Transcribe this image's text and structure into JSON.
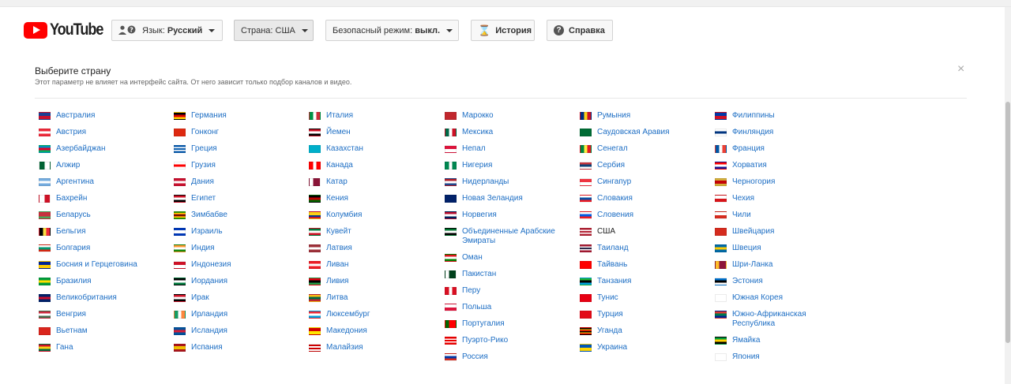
{
  "header": {
    "logo_text": "YouTube",
    "language_prefix": "Язык: ",
    "language_value": "Русский",
    "country_label": "Страна: США",
    "safety_label": "Безопасный режим: ",
    "safety_value": "выкл.",
    "history_label": "История",
    "help_label": "Справка"
  },
  "panel": {
    "title": "Выберите страну",
    "subtitle": "Этот параметр не влияет на интерфейс сайта. От него зависит только подбор каналов и видео.",
    "close_symbol": "×",
    "selected_country": "США"
  },
  "columns": [
    [
      {
        "name": "Австралия",
        "colors": [
          "#1b3f94",
          "#c8102e"
        ]
      },
      {
        "name": "Австрия",
        "colors": [
          "#ed2939",
          "#ffffff",
          "#ed2939"
        ]
      },
      {
        "name": "Азербайджан",
        "colors": [
          "#0092bc",
          "#e4002b",
          "#00af66"
        ]
      },
      {
        "name": "Алжир",
        "colors": [
          "#006233",
          "#ffffff"
        ],
        "dir": "h"
      },
      {
        "name": "Аргентина",
        "colors": [
          "#74acdf",
          "#ffffff",
          "#74acdf"
        ]
      },
      {
        "name": "Бахрейн",
        "colors": [
          "#ffffff",
          "#ce1126"
        ],
        "dir": "h"
      },
      {
        "name": "Беларусь",
        "colors": [
          "#c8313e",
          "#c8313e",
          "#4aa657"
        ]
      },
      {
        "name": "Бельгия",
        "colors": [
          "#000000",
          "#fae042",
          "#ed2939"
        ],
        "dir": "h"
      },
      {
        "name": "Болгария",
        "colors": [
          "#ffffff",
          "#00966e",
          "#d62612"
        ]
      },
      {
        "name": "Босния и Герцеговина",
        "colors": [
          "#002395",
          "#fecb00"
        ]
      },
      {
        "name": "Бразилия",
        "colors": [
          "#009c3b",
          "#ffdf00",
          "#009c3b"
        ]
      },
      {
        "name": "Великобритания",
        "colors": [
          "#012169",
          "#c8102e",
          "#012169"
        ]
      },
      {
        "name": "Венгрия",
        "colors": [
          "#cd2a3e",
          "#ffffff",
          "#436f4d"
        ]
      },
      {
        "name": "Вьетнам",
        "colors": [
          "#da251d",
          "#da251d"
        ]
      },
      {
        "name": "Гана",
        "colors": [
          "#ce1126",
          "#fcd116",
          "#006b3f"
        ]
      }
    ],
    [
      {
        "name": "Германия",
        "colors": [
          "#000000",
          "#dd0000",
          "#ffce00"
        ]
      },
      {
        "name": "Гонконг",
        "colors": [
          "#de2910",
          "#de2910"
        ]
      },
      {
        "name": "Греция",
        "colors": [
          "#0d5eaf",
          "#ffffff",
          "#0d5eaf",
          "#ffffff",
          "#0d5eaf"
        ]
      },
      {
        "name": "Грузия",
        "colors": [
          "#ffffff",
          "#ff0000",
          "#ffffff"
        ]
      },
      {
        "name": "Дания",
        "colors": [
          "#c8102e",
          "#ffffff",
          "#c8102e"
        ]
      },
      {
        "name": "Египет",
        "colors": [
          "#ce1126",
          "#ffffff",
          "#000000"
        ]
      },
      {
        "name": "Зимбабве",
        "colors": [
          "#319208",
          "#ffd200",
          "#de2010",
          "#000000",
          "#de2010",
          "#ffd200",
          "#319208"
        ]
      },
      {
        "name": "Израиль",
        "colors": [
          "#0038b8",
          "#ffffff",
          "#ffffff",
          "#0038b8"
        ]
      },
      {
        "name": "Индия",
        "colors": [
          "#ff9933",
          "#ffffff",
          "#138808"
        ]
      },
      {
        "name": "Индонезия",
        "colors": [
          "#ce1126",
          "#ffffff"
        ]
      },
      {
        "name": "Иордания",
        "colors": [
          "#000000",
          "#ffffff",
          "#007a3d"
        ]
      },
      {
        "name": "Ирак",
        "colors": [
          "#ce1126",
          "#ffffff",
          "#000000"
        ]
      },
      {
        "name": "Ирландия",
        "colors": [
          "#169b62",
          "#ffffff",
          "#ff883e"
        ],
        "dir": "h"
      },
      {
        "name": "Исландия",
        "colors": [
          "#02529c",
          "#dc1e35",
          "#02529c"
        ]
      },
      {
        "name": "Испания",
        "colors": [
          "#aa151b",
          "#f1bf00",
          "#f1bf00",
          "#aa151b"
        ]
      }
    ],
    [
      {
        "name": "Италия",
        "colors": [
          "#009246",
          "#ffffff",
          "#ce2b37"
        ],
        "dir": "h"
      },
      {
        "name": "Йемен",
        "colors": [
          "#ce1126",
          "#ffffff",
          "#000000"
        ]
      },
      {
        "name": "Казахстан",
        "colors": [
          "#00afca",
          "#00afca"
        ]
      },
      {
        "name": "Канада",
        "colors": [
          "#ff0000",
          "#ffffff",
          "#ff0000"
        ],
        "dir": "h"
      },
      {
        "name": "Катар",
        "colors": [
          "#ffffff",
          "#8a1538",
          "#8a1538"
        ],
        "dir": "h"
      },
      {
        "name": "Кения",
        "colors": [
          "#000000",
          "#bb0000",
          "#006600"
        ]
      },
      {
        "name": "Колумбия",
        "colors": [
          "#fcd116",
          "#fcd116",
          "#003893",
          "#ce1126"
        ]
      },
      {
        "name": "Кувейт",
        "colors": [
          "#007a3d",
          "#ffffff",
          "#ce1126"
        ]
      },
      {
        "name": "Латвия",
        "colors": [
          "#9e3039",
          "#ffffff",
          "#9e3039"
        ]
      },
      {
        "name": "Ливан",
        "colors": [
          "#ed1c24",
          "#ffffff",
          "#ed1c24"
        ]
      },
      {
        "name": "Ливия",
        "colors": [
          "#e70013",
          "#000000",
          "#239e46"
        ]
      },
      {
        "name": "Литва",
        "colors": [
          "#fdb913",
          "#006a44",
          "#c1272d"
        ]
      },
      {
        "name": "Люксембург",
        "colors": [
          "#ed2939",
          "#ffffff",
          "#00a1de"
        ]
      },
      {
        "name": "Македония",
        "colors": [
          "#d20000",
          "#ffe600"
        ]
      },
      {
        "name": "Малайзия",
        "colors": [
          "#cc0001",
          "#ffffff",
          "#cc0001",
          "#ffffff"
        ]
      }
    ],
    [
      {
        "name": "Марокко",
        "colors": [
          "#c1272d",
          "#c1272d"
        ]
      },
      {
        "name": "Мексика",
        "colors": [
          "#006847",
          "#ffffff",
          "#ce1126"
        ],
        "dir": "h"
      },
      {
        "name": "Непал",
        "colors": [
          "#dc143c",
          "#ffffff"
        ]
      },
      {
        "name": "Нигерия",
        "colors": [
          "#008751",
          "#ffffff",
          "#008751"
        ],
        "dir": "h"
      },
      {
        "name": "Нидерланды",
        "colors": [
          "#ae1c28",
          "#ffffff",
          "#21468b"
        ]
      },
      {
        "name": "Новая Зеландия",
        "colors": [
          "#012169",
          "#012169"
        ]
      },
      {
        "name": "Норвегия",
        "colors": [
          "#ba0c2f",
          "#ffffff",
          "#00205b"
        ]
      },
      {
        "name": "Объединенные Арабские Эмираты",
        "colors": [
          "#00732f",
          "#ffffff",
          "#000000"
        ]
      },
      {
        "name": "Оман",
        "colors": [
          "#db161b",
          "#ffffff",
          "#008000"
        ]
      },
      {
        "name": "Пакистан",
        "colors": [
          "#ffffff",
          "#01411c",
          "#01411c"
        ],
        "dir": "h"
      },
      {
        "name": "Перу",
        "colors": [
          "#d91023",
          "#ffffff",
          "#d91023"
        ],
        "dir": "h"
      },
      {
        "name": "Польша",
        "colors": [
          "#ffffff",
          "#dc143c"
        ]
      },
      {
        "name": "Португалия",
        "colors": [
          "#006600",
          "#ff0000",
          "#ff0000"
        ],
        "dir": "h"
      },
      {
        "name": "Пуэрто-Рико",
        "colors": [
          "#ed0000",
          "#ffffff",
          "#ed0000",
          "#ffffff",
          "#ed0000"
        ]
      },
      {
        "name": "Россия",
        "colors": [
          "#ffffff",
          "#0039a6",
          "#d52b1e"
        ]
      }
    ],
    [
      {
        "name": "Румыния",
        "colors": [
          "#002b7f",
          "#fcd116",
          "#ce1126"
        ],
        "dir": "h"
      },
      {
        "name": "Саудовская Аравия",
        "colors": [
          "#006c35",
          "#006c35"
        ]
      },
      {
        "name": "Сенегал",
        "colors": [
          "#00853f",
          "#fdef42",
          "#e31b23"
        ],
        "dir": "h"
      },
      {
        "name": "Сербия",
        "colors": [
          "#c6363c",
          "#0c4076",
          "#ffffff"
        ]
      },
      {
        "name": "Сингапур",
        "colors": [
          "#ef3340",
          "#ffffff"
        ]
      },
      {
        "name": "Словакия",
        "colors": [
          "#ffffff",
          "#0b4ea2",
          "#ee1c25"
        ]
      },
      {
        "name": "Словения",
        "colors": [
          "#ffffff",
          "#005ce5",
          "#ed1c24"
        ]
      },
      {
        "name": "США",
        "colors": [
          "#b22234",
          "#ffffff",
          "#b22234",
          "#ffffff",
          "#b22234"
        ]
      },
      {
        "name": "Таиланд",
        "colors": [
          "#a51931",
          "#f4f5f8",
          "#2d2a4a",
          "#f4f5f8",
          "#a51931"
        ]
      },
      {
        "name": "Тайвань",
        "colors": [
          "#fe0000",
          "#fe0000"
        ]
      },
      {
        "name": "Танзания",
        "colors": [
          "#1eb53a",
          "#000000",
          "#00a3dd"
        ]
      },
      {
        "name": "Тунис",
        "colors": [
          "#e70013",
          "#e70013"
        ]
      },
      {
        "name": "Турция",
        "colors": [
          "#e30a17",
          "#e30a17"
        ]
      },
      {
        "name": "Уганда",
        "colors": [
          "#000000",
          "#fcdc04",
          "#d90000",
          "#000000",
          "#fcdc04",
          "#d90000"
        ]
      },
      {
        "name": "Украина",
        "colors": [
          "#0057b7",
          "#ffd700"
        ]
      }
    ],
    [
      {
        "name": "Филиппины",
        "colors": [
          "#0038a8",
          "#ce1126"
        ]
      },
      {
        "name": "Финляндия",
        "colors": [
          "#ffffff",
          "#003580",
          "#ffffff"
        ]
      },
      {
        "name": "Франция",
        "colors": [
          "#0055a4",
          "#ffffff",
          "#ef4135"
        ],
        "dir": "h"
      },
      {
        "name": "Хорватия",
        "colors": [
          "#ff0000",
          "#ffffff",
          "#171796"
        ]
      },
      {
        "name": "Черногория",
        "colors": [
          "#d3ae3b",
          "#c40308",
          "#c40308",
          "#d3ae3b"
        ]
      },
      {
        "name": "Чехия",
        "colors": [
          "#ffffff",
          "#d7141a"
        ]
      },
      {
        "name": "Чили",
        "colors": [
          "#ffffff",
          "#d52b1e"
        ]
      },
      {
        "name": "Швейцария",
        "colors": [
          "#d52b1e",
          "#d52b1e"
        ]
      },
      {
        "name": "Швеция",
        "colors": [
          "#006aa7",
          "#fecc00",
          "#006aa7"
        ]
      },
      {
        "name": "Шри-Ланка",
        "colors": [
          "#ffbe29",
          "#8d153a",
          "#8d153a"
        ],
        "dir": "h"
      },
      {
        "name": "Эстония",
        "colors": [
          "#0072ce",
          "#000000",
          "#ffffff"
        ]
      },
      {
        "name": "Южная Корея",
        "colors": [
          "#ffffff",
          "#ffffff"
        ]
      },
      {
        "name": "Южно-Африканская Республика",
        "colors": [
          "#de3831",
          "#007a4d",
          "#002395"
        ]
      },
      {
        "name": "Ямайка",
        "colors": [
          "#009b3a",
          "#fed100",
          "#000000"
        ]
      },
      {
        "name": "Япония",
        "colors": [
          "#ffffff",
          "#ffffff"
        ]
      }
    ]
  ]
}
